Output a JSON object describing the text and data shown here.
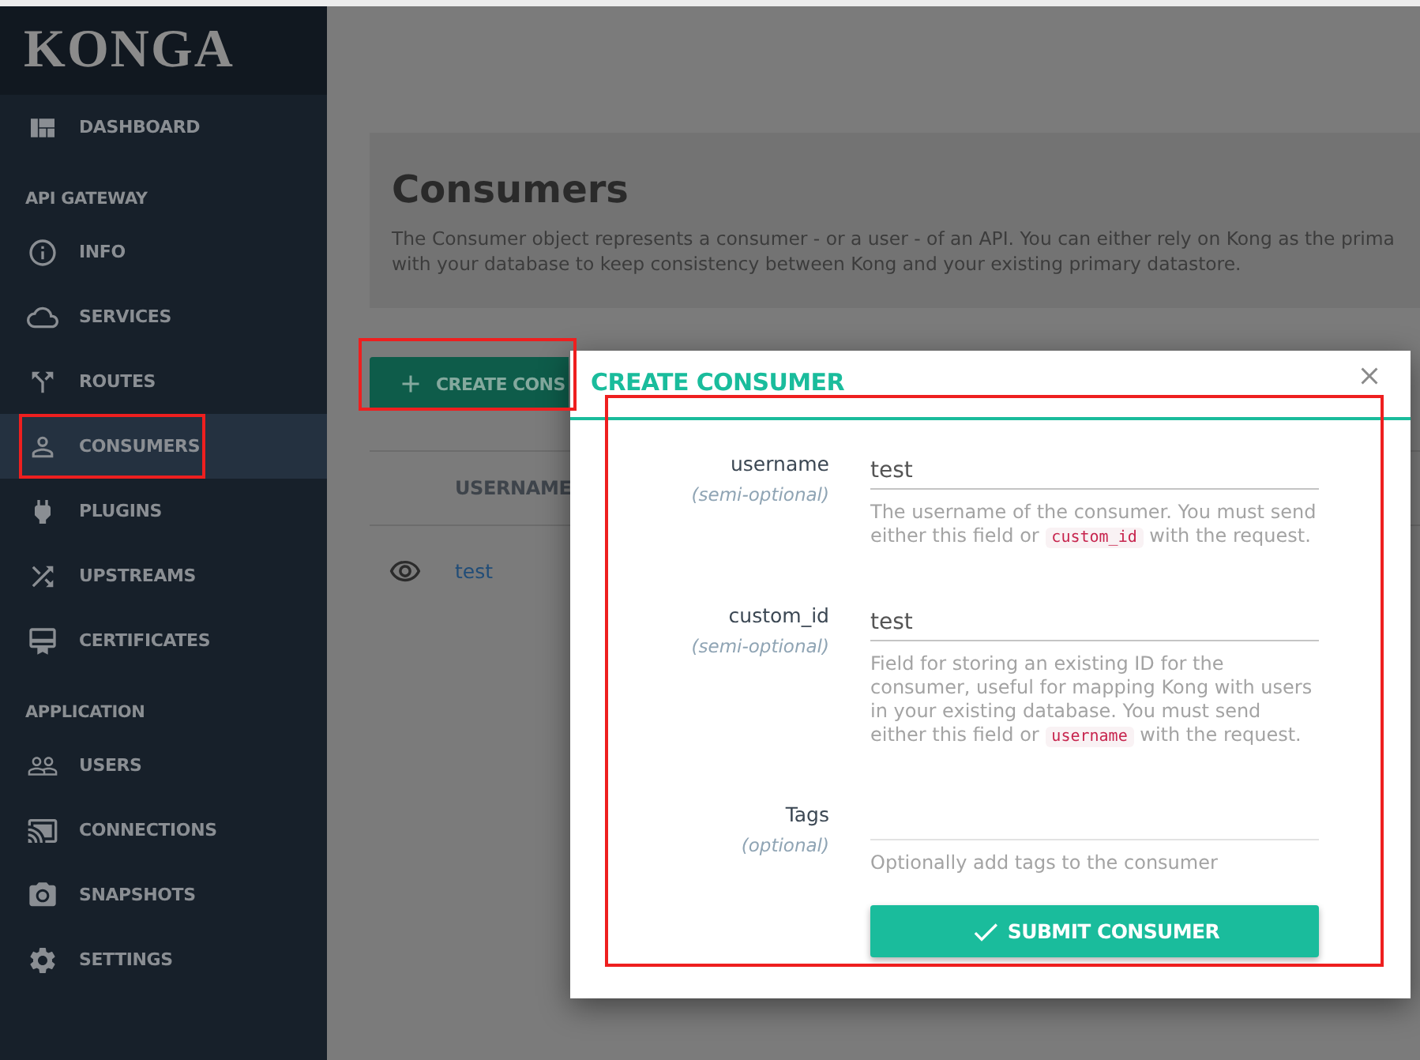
{
  "sidebar": {
    "logo": "KONGA",
    "sections": [
      {
        "items": [
          {
            "label": "DASHBOARD",
            "selected": false,
            "annotated": false
          }
        ]
      },
      {
        "title": "API GATEWAY",
        "items": [
          {
            "label": "INFO",
            "selected": false,
            "annotated": false
          },
          {
            "label": "SERVICES",
            "selected": false,
            "annotated": false
          },
          {
            "label": "ROUTES",
            "selected": false,
            "annotated": false
          },
          {
            "label": "CONSUMERS",
            "selected": true,
            "annotated": true
          },
          {
            "label": "PLUGINS",
            "selected": false,
            "annotated": false
          },
          {
            "label": "UPSTREAMS",
            "selected": false,
            "annotated": false
          },
          {
            "label": "CERTIFICATES",
            "selected": false,
            "annotated": false
          }
        ]
      },
      {
        "title": "APPLICATION",
        "items": [
          {
            "label": "USERS",
            "selected": false,
            "annotated": false
          },
          {
            "label": "CONNECTIONS",
            "selected": false,
            "annotated": false
          },
          {
            "label": "SNAPSHOTS",
            "selected": false,
            "annotated": false
          },
          {
            "label": "SETTINGS",
            "selected": false,
            "annotated": false
          }
        ]
      }
    ]
  },
  "page_header": {
    "title": "Consumers",
    "description_lines": [
      "The Consumer object represents a consumer - or a user - of an API. You can either rely on Kong as the prima",
      "with your database to keep consistency between Kong and your existing primary datastore."
    ]
  },
  "create_button": {
    "label": "CREATE CONS",
    "annotated": true
  },
  "table": {
    "columns": [
      "USERNAME"
    ],
    "rows": [
      {
        "username": "test"
      }
    ]
  },
  "modal": {
    "title": "CREATE CONSUMER",
    "form": {
      "annotated": true,
      "fields": [
        {
          "label": "username",
          "requirement": "(semi-optional)",
          "value": "test",
          "help": [
            {
              "kind": "text",
              "text": "The username of the consumer. You must send either this field or "
            },
            {
              "kind": "code",
              "text": "custom_id"
            },
            {
              "kind": "text",
              "text": " with the request."
            }
          ]
        },
        {
          "label": "custom_id",
          "requirement": "(semi-optional)",
          "value": "test",
          "help": [
            {
              "kind": "text",
              "text": "Field for storing an existing ID for the consumer, useful for mapping Kong with users in your existing database. You must send either this field or "
            },
            {
              "kind": "code",
              "text": "username"
            },
            {
              "kind": "text",
              "text": " with the request."
            }
          ]
        },
        {
          "label": "Tags",
          "requirement": "(optional)",
          "help": [
            {
              "kind": "text",
              "text": "Optionally add tags to the consumer"
            }
          ]
        }
      ],
      "submit_label": "SUBMIT CONSUMER"
    }
  }
}
